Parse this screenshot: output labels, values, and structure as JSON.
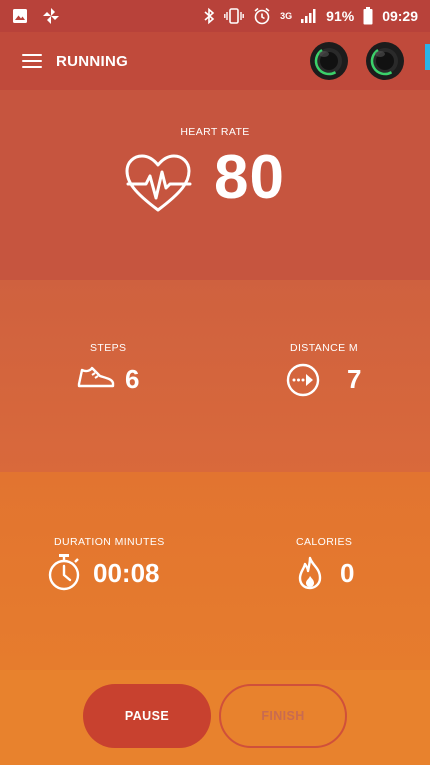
{
  "status_bar": {
    "battery": "91%",
    "time": "09:29",
    "network": "3G"
  },
  "app_bar": {
    "title": "RUNNING"
  },
  "heart_rate": {
    "label": "HEART RATE",
    "value": "80"
  },
  "steps": {
    "label": "STEPS",
    "value": "6"
  },
  "distance": {
    "label": "DISTANCE M",
    "value": "7"
  },
  "duration": {
    "label": "DURATION MINUTES",
    "value": "00:08"
  },
  "calories": {
    "label": "CALORIES",
    "value": "0"
  },
  "actions": {
    "pause": "PAUSE",
    "finish": "FINISH"
  },
  "colors": {
    "accent": "#c8412f",
    "status_bar": "#b8423a",
    "earbud_ring": "#3bd16a"
  }
}
